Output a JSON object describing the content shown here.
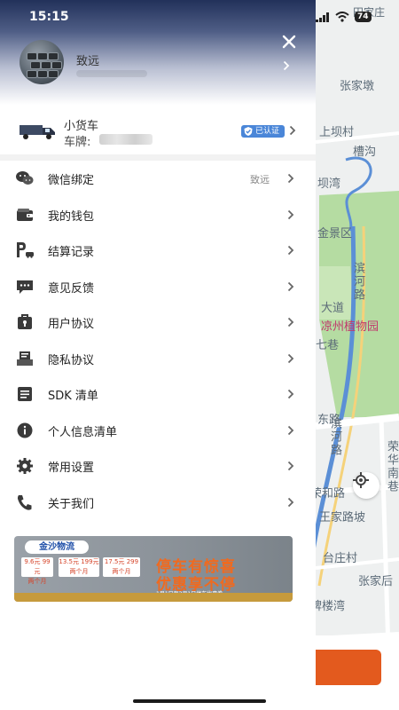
{
  "status_bar": {
    "time": "15:15",
    "battery": "74"
  },
  "drawer": {
    "user": {
      "name": "致远"
    },
    "vehicle": {
      "title": "小货车",
      "plate_label": "车牌:",
      "verified_label": "已认证"
    },
    "menu": [
      {
        "label": "微信绑定",
        "value": "致远",
        "icon": "wechat-icon"
      },
      {
        "label": "我的钱包",
        "icon": "wallet-icon"
      },
      {
        "label": "结算记录",
        "icon": "parking-icon"
      },
      {
        "label": "意见反馈",
        "icon": "feedback-icon"
      },
      {
        "label": "用户协议",
        "icon": "agreement-icon"
      },
      {
        "label": "隐私协议",
        "icon": "privacy-icon"
      },
      {
        "label": "SDK 清单",
        "icon": "list-icon"
      },
      {
        "label": "个人信息清单",
        "icon": "info-icon"
      },
      {
        "label": "常用设置",
        "icon": "gear-icon"
      },
      {
        "label": "关于我们",
        "icon": "phone-icon"
      }
    ],
    "banner": {
      "logo": "金沙物流",
      "headline_1": "停车有惊喜",
      "headline_2": "优惠享不停",
      "tiles": [
        {
          "price": "9.6元 99元",
          "term": "两个月"
        },
        {
          "price": "13.5元 199元",
          "term": "两个月"
        },
        {
          "price": "17.5元 299",
          "term": "两个月"
        }
      ],
      "note": "1月1日至3月1日停车优惠券"
    }
  },
  "map": {
    "labels": [
      "田家庄",
      "张家墩",
      "上坝村",
      "槽沟",
      "坝湾",
      "金景区",
      "滨河路",
      "大道",
      "凉州植物园",
      "七巷",
      "东路",
      "滨河路",
      "荣华南巷",
      "荣和路",
      "王家路坡",
      "台庄村",
      "张家后",
      "牌楼湾"
    ]
  },
  "colors": {
    "accent": "#4a86d8",
    "orange": "#e35a1e",
    "river": "#5b8fd6",
    "park": "#b5dca2"
  }
}
